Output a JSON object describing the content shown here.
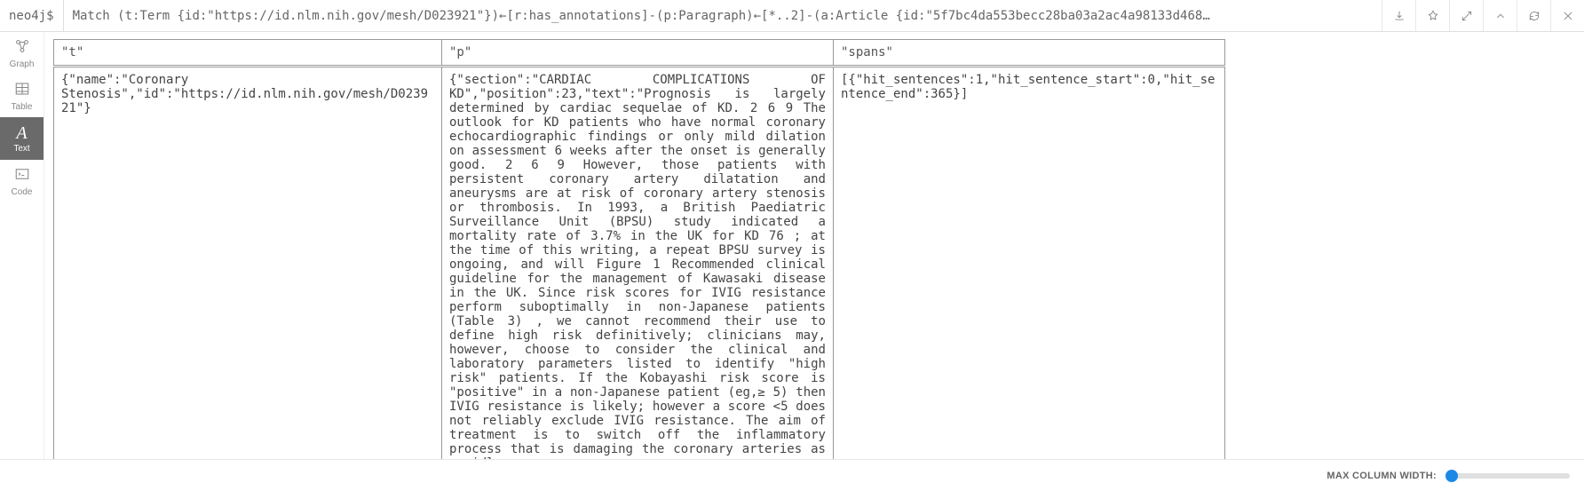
{
  "prompt": "neo4j$",
  "query": "Match (t:Term {id:\"https://id.nlm.nih.gov/mesh/D023921\"})←[r:has_annotations]-(p:Paragraph)←[*..2]-(a:Article {id:\"5f7bc4da553becc28ba03a2ac4a98133d468…",
  "sidebar": {
    "items": [
      {
        "label": "Graph"
      },
      {
        "label": "Table"
      },
      {
        "label": "Text"
      },
      {
        "label": "Code"
      }
    ],
    "active_index": 2
  },
  "top_actions": {
    "download": "download-icon",
    "pin": "pin-icon",
    "expand": "expand-icon",
    "collapse_up": "chevron-up-icon",
    "refresh": "refresh-icon",
    "close": "close-icon"
  },
  "table": {
    "headers": [
      "\"t\"",
      "\"p\"",
      "\"spans\""
    ],
    "row": {
      "t": "{\"name\":\"Coronary Stenosis\",\"id\":\"https://id.nlm.nih.gov/mesh/D023921\"}",
      "p": "{\"section\":\"CARDIAC COMPLICATIONS OF KD\",\"position\":23,\"text\":\"Prognosis is largely determined by cardiac sequelae of KD. 2 6 9 The outlook for KD patients who have normal coronary echocardiographic findings or only mild dilation on assessment 6 weeks after the onset is generally good. 2 6 9 However, those patients with persistent coronary artery dilatation and aneurysms are at risk of coronary artery stenosis or thrombosis. In 1993, a British Paediatric Surveillance Unit (BPSU) study indicated a mortality rate of 3.7% in the UK for KD 76 ; at the time of this writing, a repeat BPSU survey is ongoing, and will Figure 1 Recommended clinical guideline for the management of Kawasaki disease in the UK. Since risk scores for IVIG resistance perform suboptimally in non-Japanese patients (Table 3) , we cannot recommend their use to define high risk definitively; clinicians may, however, choose to consider the clinical and laboratory parameters listed to identify \"high risk\" patients. If the Kobayashi risk score is \"positive\" in a non-Japanese patient (eg,≥ 5) then IVIG resistance is likely; however a score <5 does not reliably exclude IVIG resistance. The aim of treatment is to switch off the inflammatory process that is damaging the coronary arteries as rapidly",
      "spans": "[{\"hit_sentences\":1,\"hit_sentence_start\":0,\"hit_sentence_end\":365}]"
    }
  },
  "footer": {
    "slider_label": "MAX COLUMN WIDTH:"
  }
}
